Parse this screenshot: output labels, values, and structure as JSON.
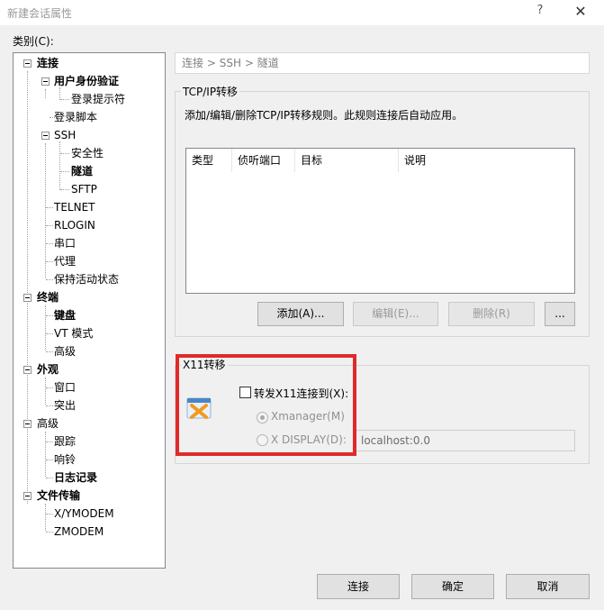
{
  "window": {
    "title": "新建会话属性",
    "help_glyph": "?",
    "close_glyph": "✕"
  },
  "category_label": "类别(C):",
  "tree": {
    "items": [
      {
        "label": "连接"
      },
      {
        "label": "用户身份验证"
      },
      {
        "label": "登录提示符"
      },
      {
        "label": "登录脚本"
      },
      {
        "label": "SSH"
      },
      {
        "label": "安全性"
      },
      {
        "label": "隧道"
      },
      {
        "label": "SFTP"
      },
      {
        "label": "TELNET"
      },
      {
        "label": "RLOGIN"
      },
      {
        "label": "串口"
      },
      {
        "label": "代理"
      },
      {
        "label": "保持活动状态"
      },
      {
        "label": "终端"
      },
      {
        "label": "键盘"
      },
      {
        "label": "VT 模式"
      },
      {
        "label": "高级"
      },
      {
        "label": "外观"
      },
      {
        "label": "窗口"
      },
      {
        "label": "突出"
      },
      {
        "label": "高级"
      },
      {
        "label": "跟踪"
      },
      {
        "label": "响铃"
      },
      {
        "label": "日志记录"
      },
      {
        "label": "文件传输"
      },
      {
        "label": "X/YMODEM"
      },
      {
        "label": "ZMODEM"
      }
    ]
  },
  "breadcrumb": {
    "part1": "连接",
    "sep1": ">",
    "part2": "SSH",
    "sep2": ">",
    "part3": "隧道"
  },
  "tcpip": {
    "title": "TCP/IP转移",
    "description": "添加/编辑/删除TCP/IP转移规则。此规则连接后自动应用。",
    "columns": [
      "类型",
      "侦听端口",
      "目标",
      "说明"
    ],
    "add_label": "添加(A)...",
    "edit_label": "编辑(E)...",
    "delete_label": "删除(R)",
    "more_label": "..."
  },
  "x11": {
    "title": "X11转移",
    "forward_label": "转发X11连接到(X):",
    "forward_checked": false,
    "xmanager_label": "Xmanager(M)",
    "display_label": "X DISPLAY(D):",
    "display_value": "localhost:0.0",
    "selected": "Xmanager(M)"
  },
  "footer": {
    "connect_label": "连接",
    "ok_label": "确定",
    "cancel_label": "取消"
  },
  "colors": {
    "highlight_border": "#e02a2a"
  }
}
